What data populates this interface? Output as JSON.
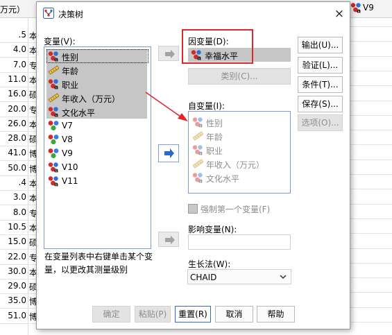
{
  "background": {
    "header_label": "万元）",
    "header_right_label": "V9",
    "rows": [
      {
        "num": ".5",
        "txt": "本"
      },
      {
        "num": "4.0",
        "txt": "本"
      },
      {
        "num": "7.0",
        "txt": "专"
      },
      {
        "num": "11.0",
        "txt": "本"
      },
      {
        "num": "16.0",
        "txt": "硕"
      },
      {
        "num": "20.0",
        "txt": "专"
      },
      {
        "num": "26.0",
        "txt": "本"
      },
      {
        "num": "28.0",
        "txt": "硕"
      },
      {
        "num": "41.0",
        "txt": "博"
      },
      {
        "num": "50.0",
        "txt": "博"
      },
      {
        "num": ".4",
        "txt": "本"
      },
      {
        "num": "3.0",
        "txt": "本"
      },
      {
        "num": "8.0",
        "txt": "专"
      },
      {
        "num": "10.5",
        "txt": "本"
      },
      {
        "num": "15.0",
        "txt": "硕"
      },
      {
        "num": "22.0",
        "txt": "专"
      },
      {
        "num": "30.0",
        "txt": "本"
      },
      {
        "num": "29.0",
        "txt": "硕"
      },
      {
        "num": "35.0",
        "txt": "博"
      },
      {
        "num": "51.0",
        "txt": "博"
      }
    ]
  },
  "dialog": {
    "title": "决策树",
    "close": "×",
    "variables_label": "变量(V):",
    "variables": [
      {
        "label": "性别",
        "icon": "nominal-icon",
        "selected": true
      },
      {
        "label": "年龄",
        "icon": "scale-icon",
        "selected": true
      },
      {
        "label": "职业",
        "icon": "nominal-icon",
        "selected": true
      },
      {
        "label": "年收入（万元）",
        "icon": "scale-icon",
        "selected": true
      },
      {
        "label": "文化水平",
        "icon": "nominal-icon",
        "selected": true
      },
      {
        "label": "V7",
        "icon": "nominal-color-icon",
        "selected": false
      },
      {
        "label": "V8",
        "icon": "nominal-color-icon",
        "selected": false
      },
      {
        "label": "V9",
        "icon": "nominal-color-icon",
        "selected": false
      },
      {
        "label": "V10",
        "icon": "nominal-icon",
        "selected": false
      },
      {
        "label": "V11",
        "icon": "nominal-icon",
        "selected": false
      }
    ],
    "help_text": "在变量列表中右键单击某个变量，以更改其测量级别",
    "dependent_label": "因变量(D):",
    "dependent_value": "幸福水平",
    "category_button": "类别(C)...",
    "independent_label": "自变量(I):",
    "independents": [
      {
        "label": "性别",
        "icon": "nominal-icon"
      },
      {
        "label": "年龄",
        "icon": "scale-icon"
      },
      {
        "label": "职业",
        "icon": "nominal-icon"
      },
      {
        "label": "年收入（万元）",
        "icon": "scale-icon"
      },
      {
        "label": "文化水平",
        "icon": "nominal-icon"
      }
    ],
    "force_first_label": "强制第一个变量(F)",
    "influence_label": "影响变量(N):",
    "growth_label": "生长法(W):",
    "growth_value": "CHAID",
    "side_buttons": {
      "output": "输出(U)...",
      "validation": "验证(L)...",
      "criteria": "条件(T)...",
      "save": "保存(S)...",
      "options": "选项(O)..."
    },
    "bottom_buttons": {
      "ok": "确定",
      "paste": "粘贴(P)",
      "reset": "重置(R)",
      "cancel": "取消",
      "help": "帮助"
    },
    "colors": {
      "highlight_red": "#e0262b",
      "selection_gray": "#c6c6c6",
      "focus_blue": "#2f6bd0"
    }
  }
}
